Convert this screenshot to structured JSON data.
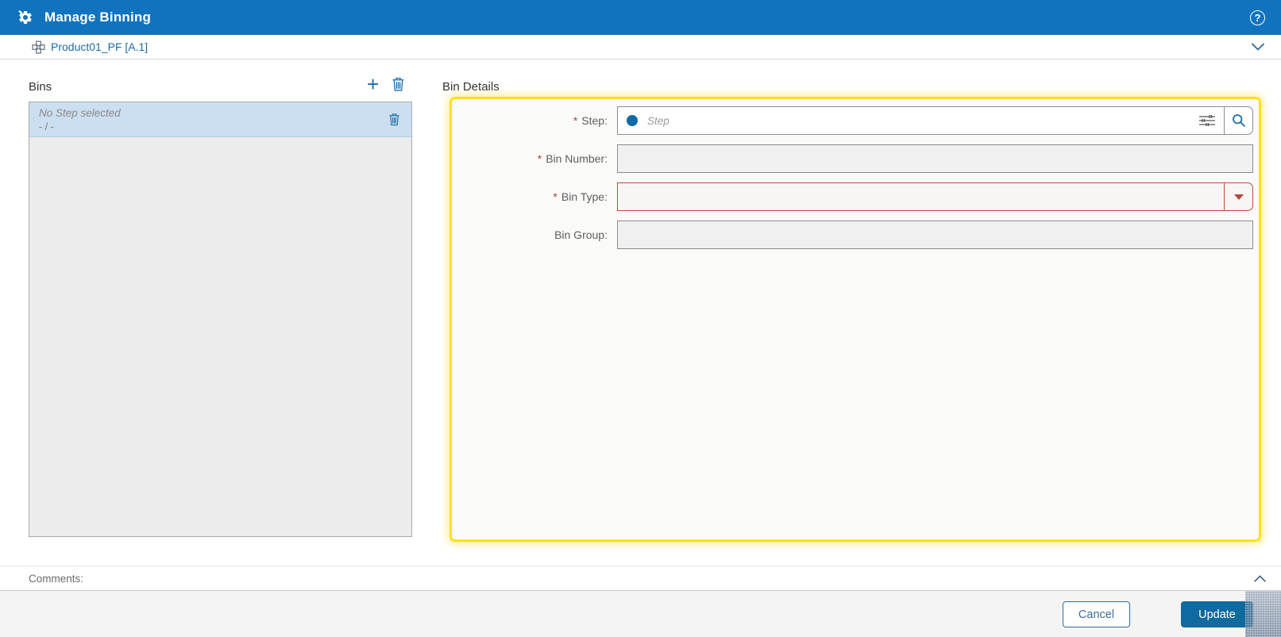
{
  "header": {
    "title": "Manage Binning",
    "help_label": "?"
  },
  "context_bar": {
    "product_label": "Product01_PF [A.1]"
  },
  "bins": {
    "title": "Bins",
    "add_symbol": "+",
    "items": [
      {
        "title": "No Step selected",
        "subtitle": "- / -",
        "selected": true
      }
    ]
  },
  "bin_details": {
    "title": "Bin Details",
    "required_marker": "*",
    "fields": [
      {
        "label": "Step:",
        "required": true,
        "type": "lookup",
        "placeholder": "Step",
        "value": ""
      },
      {
        "label": "Bin Number:",
        "required": true,
        "type": "text",
        "value": ""
      },
      {
        "label": "Bin Type:",
        "required": true,
        "type": "dropdown",
        "value": "",
        "state": "invalid"
      },
      {
        "label": "Bin Group:",
        "required": false,
        "type": "text",
        "value": ""
      }
    ]
  },
  "comments": {
    "label": "Comments:"
  },
  "footer": {
    "cancel_label": "Cancel",
    "update_label": "Update"
  },
  "colors": {
    "header_bg": "#1173BE",
    "accent_blue": "#1B6CA8",
    "primary_button_bg": "#0E6A9F",
    "selected_item_bg": "#CBDFF0",
    "list_bg": "#ECECEC",
    "highlight_border": "#FFE01A",
    "error_border": "#BE4A42",
    "required_asterisk": "#A94442",
    "field_bg": "#F0F0F0"
  }
}
